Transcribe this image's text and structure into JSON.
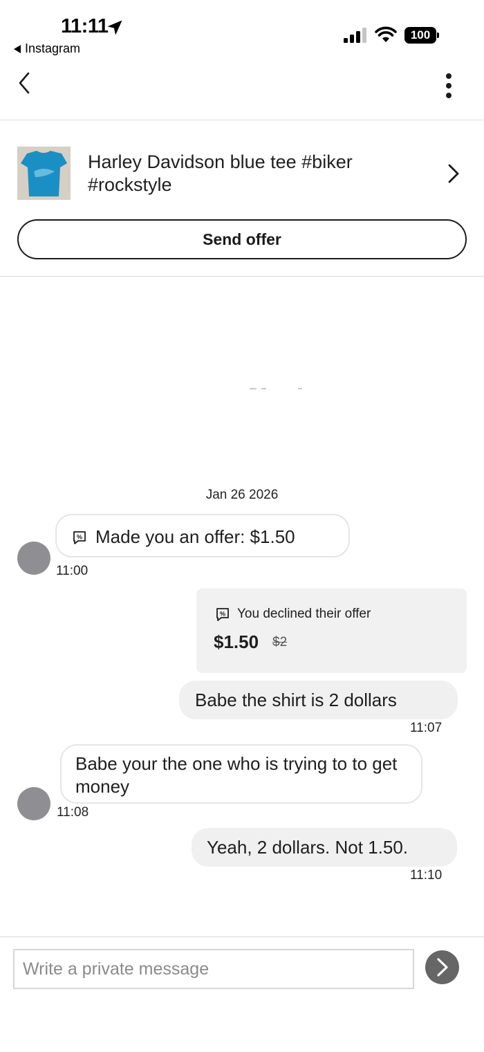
{
  "status_bar": {
    "time": "11:11",
    "back_app_label": "Instagram",
    "battery": "100",
    "icons": [
      "location-arrow-icon",
      "cellular-signal-icon",
      "wifi-icon",
      "battery-icon"
    ]
  },
  "nav": {
    "icons": [
      "chevron-left-icon",
      "more-vertical-icon"
    ]
  },
  "listing": {
    "title": "Harley Davidson blue tee #biker #rockstyle",
    "send_offer_label": "Send offer",
    "thumbnail_color": "#1a8fc4"
  },
  "conversation": {
    "date": "Jan 26 2026",
    "offer_message": {
      "text": "Made you an offer: $1.50",
      "time": "11:00"
    },
    "declined_card": {
      "text": "You declined their offer",
      "price": "$1.50",
      "original_price": "$2"
    },
    "message_3": {
      "text": "Babe the shirt is 2 dollars",
      "time": "11:07"
    },
    "message_4": {
      "text": "Babe your the one who is trying to to get money",
      "time": "11:08"
    },
    "message_5": {
      "text": "Yeah, 2 dollars. Not 1.50.",
      "time": "11:10"
    }
  },
  "composer": {
    "placeholder": "Write a private message",
    "send_button_color": "#666666"
  },
  "colors": {
    "incoming_bubble_border": "#e6e6e6",
    "outgoing_bubble": "#f0f0f0",
    "avatar": "#8e8e93"
  }
}
